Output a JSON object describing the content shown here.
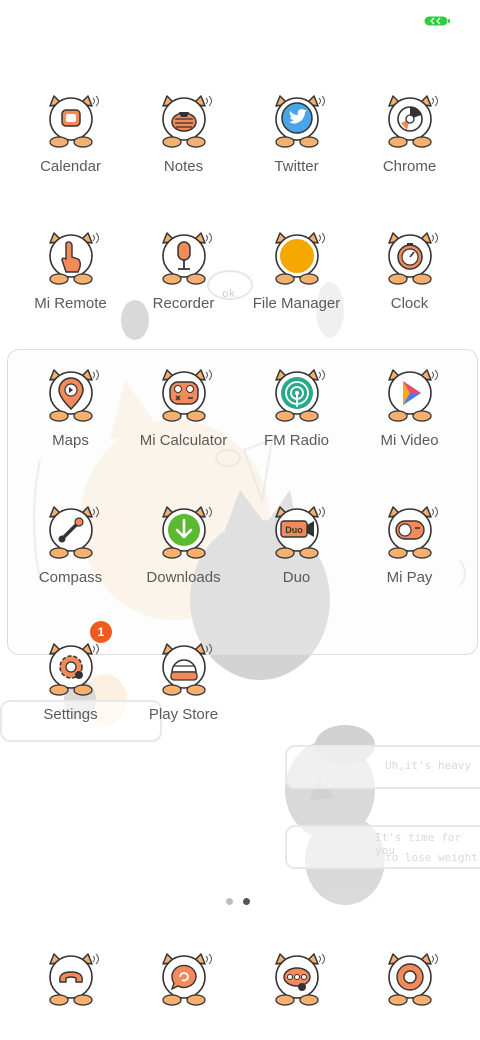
{
  "status_bar": {
    "battery_color": "#2ecc40"
  },
  "apps": [
    {
      "label": "Calendar",
      "icon": "calendar-icon"
    },
    {
      "label": "Notes",
      "icon": "notes-icon"
    },
    {
      "label": "Twitter",
      "icon": "twitter-icon"
    },
    {
      "label": "Chrome",
      "icon": "chrome-icon"
    },
    {
      "label": "Mi Remote",
      "icon": "mi-remote-icon"
    },
    {
      "label": "Recorder",
      "icon": "recorder-icon"
    },
    {
      "label": "File Manager",
      "icon": "file-manager-icon"
    },
    {
      "label": "Clock",
      "icon": "clock-icon"
    },
    {
      "label": "Maps",
      "icon": "maps-icon"
    },
    {
      "label": "Mi Calculator",
      "icon": "calculator-icon"
    },
    {
      "label": "FM Radio",
      "icon": "radio-icon"
    },
    {
      "label": "Mi Video",
      "icon": "video-icon"
    },
    {
      "label": "Compass",
      "icon": "compass-icon"
    },
    {
      "label": "Downloads",
      "icon": "downloads-icon"
    },
    {
      "label": "Duo",
      "icon": "duo-icon"
    },
    {
      "label": "Mi Pay",
      "icon": "mi-pay-icon"
    },
    {
      "label": "Settings",
      "icon": "settings-icon",
      "badge": "1"
    },
    {
      "label": "Play Store",
      "icon": "play-store-icon"
    }
  ],
  "dock": [
    {
      "icon": "phone-icon"
    },
    {
      "icon": "messages-icon"
    },
    {
      "icon": "browser-icon"
    },
    {
      "icon": "camera-icon"
    }
  ],
  "wallpaper": {
    "bubble_1": "Uh,it's heavy",
    "bubble_2_line1": "It's time for you",
    "bubble_2_line2": "to lose weight",
    "bubble_ok": "ok"
  },
  "page_indicator": {
    "pages": 2,
    "current": 2,
    "active_color": "#555555",
    "inactive_color": "#bdbdbd"
  }
}
